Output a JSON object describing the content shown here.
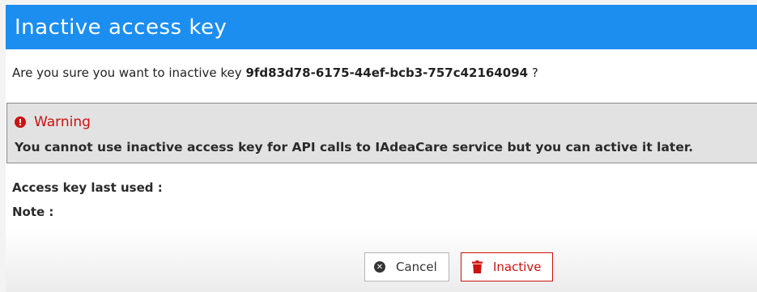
{
  "dialog": {
    "title": "Inactive access key",
    "confirm": {
      "prefix": "Are you sure you want to inactive key",
      "key": "9fd83d78-6175-44ef-bcb3-757c42164094",
      "suffix": "?"
    },
    "warning": {
      "heading": "Warning",
      "message": "You cannot use inactive access key for API calls to IAdeaCare service but you can active it later.",
      "icon": "exclamation-circle-icon"
    },
    "fields": {
      "last_used_label": "Access key last used :",
      "note_label": "Note :"
    },
    "buttons": {
      "cancel_label": "Cancel",
      "cancel_icon": "close-circle-icon",
      "inactive_label": "Inactive",
      "inactive_icon": "trash-icon"
    }
  },
  "colors": {
    "title_bar": "#1b8ef0",
    "warning_red": "#cc1111",
    "warning_bg": "#e2e2e2"
  }
}
